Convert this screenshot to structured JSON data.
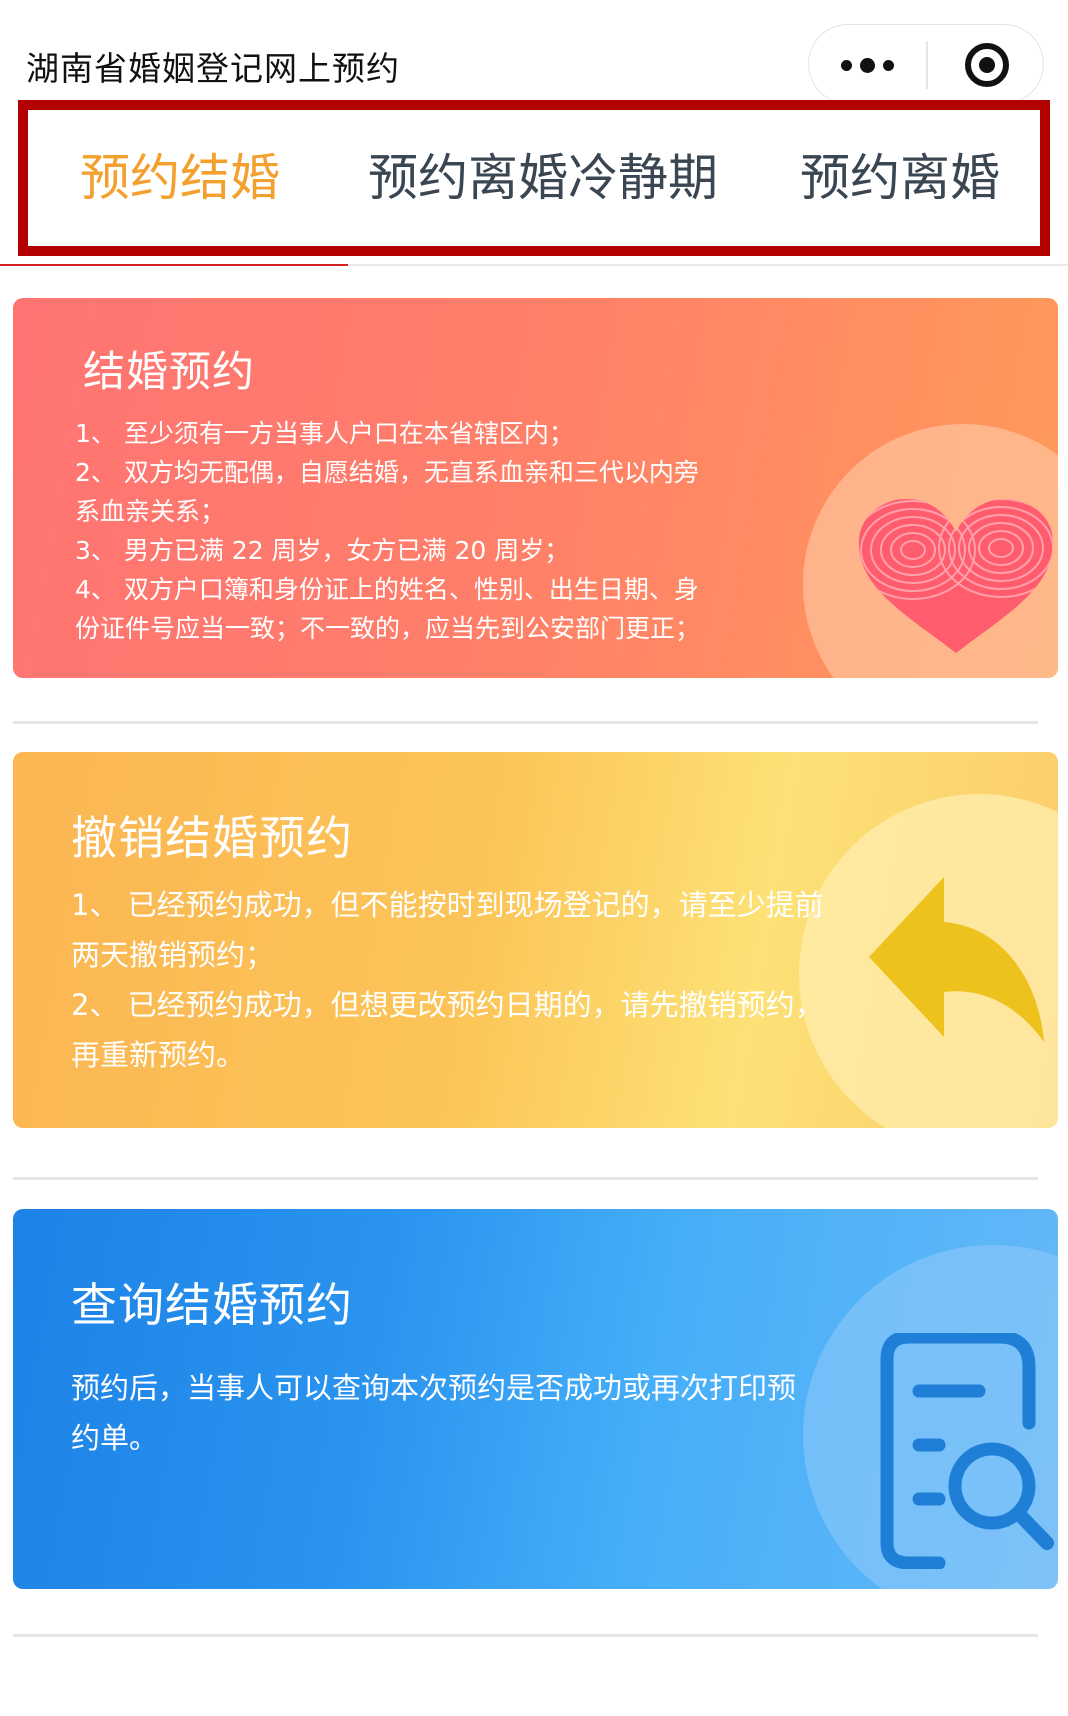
{
  "app": {
    "title": "湖南省婚姻登记网上预约"
  },
  "capsule": {
    "more_icon": "more-dots-icon",
    "close_icon": "target-close-icon"
  },
  "tabs": [
    {
      "label": "预约结婚",
      "active": true
    },
    {
      "label": "预约离婚冷静期",
      "active": false
    },
    {
      "label": "预约离婚",
      "active": false
    }
  ],
  "colors": {
    "tab_active": "#f3a02e",
    "tab_inactive": "#3a4652",
    "highlight_border": "#b30000",
    "card_marriage": "#ff7e6a",
    "card_cancel": "#fcc558",
    "card_query": "#2a94ef"
  },
  "cards": [
    {
      "title": "结婚预约",
      "icon": "fingerprint-heart-icon",
      "lines": [
        "1、 至少须有一方当事人户口在本省辖区内；",
        "2、 双方均无配偶，自愿结婚，无直系血亲和三代以内旁",
        "系血亲关系；",
        "3、 男方已满 22 周岁，女方已满 20 周岁；",
        "4、 双方户口簿和身份证上的姓名、性别、出生日期、身",
        "份证件号应当一致；不一致的，应当先到公安部门更正；"
      ]
    },
    {
      "title": "撤销结婚预约",
      "icon": "undo-arrow-icon",
      "lines": [
        "1、 已经预约成功，但不能按时到现场登记的，请至少提前",
        "两天撤销预约；",
        "2、 已经预约成功，但想更改预约日期的，请先撤销预约，",
        "再重新预约。"
      ]
    },
    {
      "title": "查询结婚预约",
      "icon": "document-search-icon",
      "lines": [
        "预约后，当事人可以查询本次预约是否成功或再次打印预",
        "约单。"
      ]
    }
  ]
}
